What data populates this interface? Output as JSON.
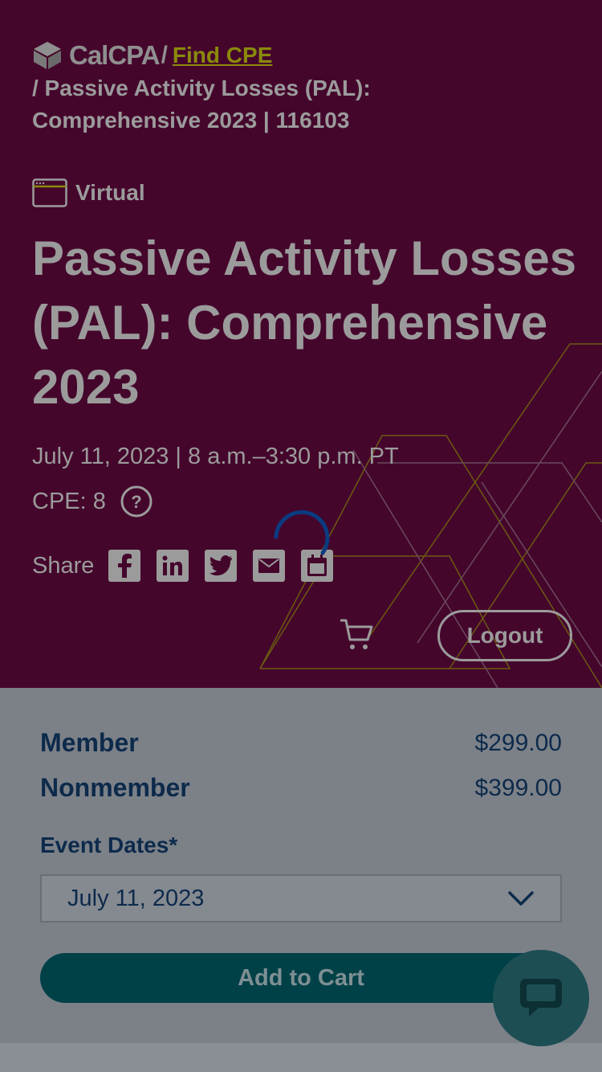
{
  "breadcrumb": {
    "logo_text": "CalCPA",
    "separator": "/",
    "link": "Find CPE",
    "rest": "/ Passive Activity Losses (PAL): Comprehensive 2023 | 116103"
  },
  "event": {
    "format": "Virtual",
    "title": "Passive Activity Losses (PAL): Comprehensive 2023",
    "date": "July 11, 2023 | 8 a.m.–3:30 p.m. PT",
    "cpe": "CPE: 8",
    "share_label": "Share"
  },
  "share_icons": [
    "facebook-icon",
    "linkedin-icon",
    "twitter-icon",
    "email-icon",
    "calendar-icon"
  ],
  "header_actions": {
    "logout_label": "Logout"
  },
  "pricing": {
    "member_label": "Member",
    "member_price": "$299.00",
    "nonmember_label": "Nonmember",
    "nonmember_price": "$399.00"
  },
  "event_dates": {
    "label": "Event Dates*",
    "selected": "July 11, 2023"
  },
  "add_to_cart_label": "Add to Cart",
  "colors": {
    "hero_bg": "#45062c",
    "link": "#8a8a0c",
    "text_dim": "#9b9b9b",
    "navy": "#0d2a4b",
    "button_teal": "#004148",
    "spinner": "#0b3b80"
  }
}
